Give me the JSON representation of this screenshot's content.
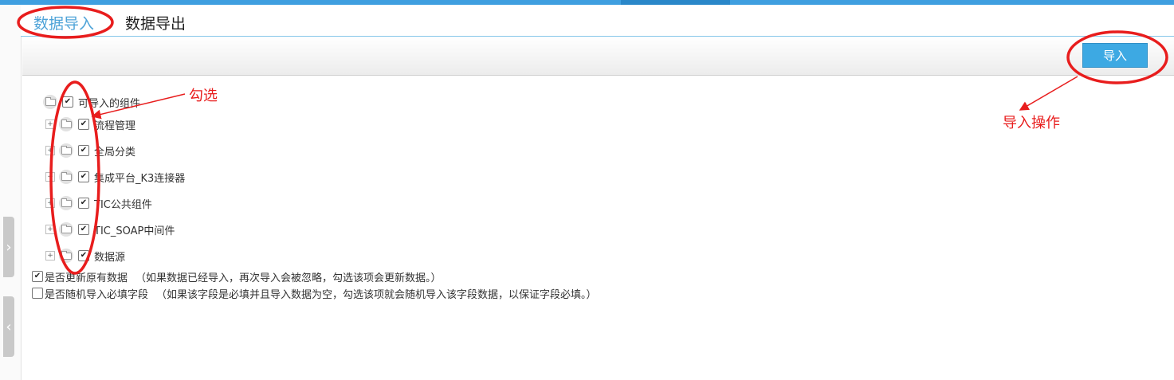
{
  "tabs": [
    {
      "label": "数据导入",
      "active": true
    },
    {
      "label": "数据导出",
      "active": false
    }
  ],
  "toolbar": {
    "import_label": "导入"
  },
  "tree": {
    "root": {
      "label": "可导入的组件",
      "checked": true
    },
    "children": [
      {
        "label": "流程管理",
        "checked": true
      },
      {
        "label": "全局分类",
        "checked": true
      },
      {
        "label": "集成平台_K3连接器",
        "checked": true
      },
      {
        "label": "TIC公共组件",
        "checked": true
      },
      {
        "label": "TIC_SOAP中间件",
        "checked": true
      },
      {
        "label": "数据源",
        "checked": true
      }
    ]
  },
  "options": [
    {
      "label": "是否更新原有数据",
      "hint": "（如果数据已经导入，再次导入会被忽略，勾选该项会更新数据。）",
      "checked": true
    },
    {
      "label": "是否随机导入必填字段",
      "hint": "（如果该字段是必填并且导入数据为空，勾选该项就会随机导入该字段数据，以保证字段必填。）",
      "checked": false
    }
  ],
  "annotations": {
    "check_note": "勾选",
    "import_note": "导入操作"
  },
  "colors": {
    "accent": "#3da9e3",
    "annotation": "#e81d1d",
    "topbar": "#3f9fe0"
  }
}
